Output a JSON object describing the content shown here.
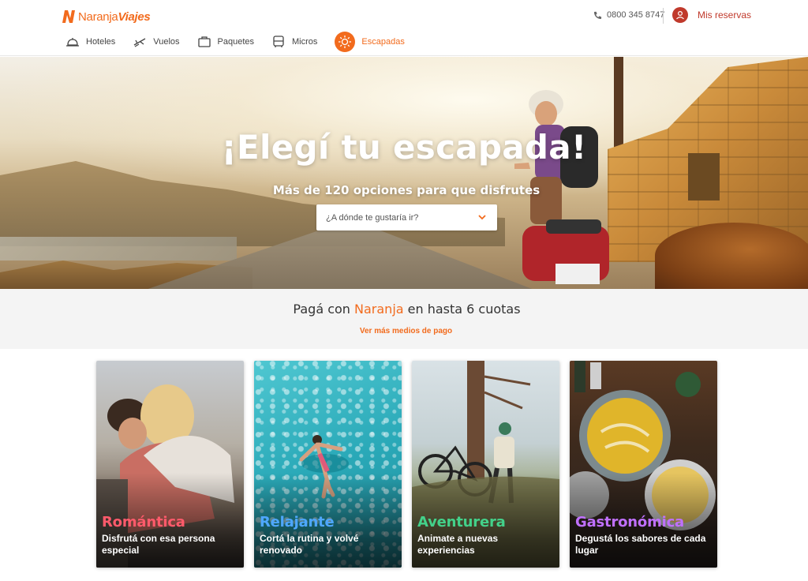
{
  "brand": {
    "logo_part1": "Naranja",
    "logo_part2": "Viajes"
  },
  "header": {
    "phone": "0800 345 8747",
    "reservas": "Mis reservas"
  },
  "nav": [
    {
      "label": "Hoteles",
      "icon": "hotel-bell-icon"
    },
    {
      "label": "Vuelos",
      "icon": "plane-icon"
    },
    {
      "label": "Paquetes",
      "icon": "suitcase-icon"
    },
    {
      "label": "Micros",
      "icon": "bus-icon"
    },
    {
      "label": "Escapadas",
      "icon": "sun-icon",
      "active": true
    }
  ],
  "hero": {
    "title": "¡Elegí tu escapada!",
    "subtitle": "Más de 120 opciones para que disfrutes",
    "select_placeholder": "¿A dónde te gustaría ir?"
  },
  "payment": {
    "prefix": "Pagá con ",
    "brand": "Naranja",
    "suffix": " en hasta 6 cuotas",
    "link": "Ver más medios de pago"
  },
  "cards": [
    {
      "title": "Romántica",
      "desc": "Disfrutá con esa persona especial"
    },
    {
      "title": "Relajante",
      "desc": "Cortá la rutina y volvé renovado"
    },
    {
      "title": "Aventurera",
      "desc": "Animate a nuevas experiencias"
    },
    {
      "title": "Gastronómica",
      "desc": "Degustá los sabores de cada lugar"
    }
  ],
  "colors": {
    "accent": "#f26b1d",
    "reservas": "#c0392b",
    "romantica": "#ff5a6b",
    "relajante": "#4ea7ff",
    "aventurera": "#43d18a",
    "gastronomica": "#c070ff"
  }
}
